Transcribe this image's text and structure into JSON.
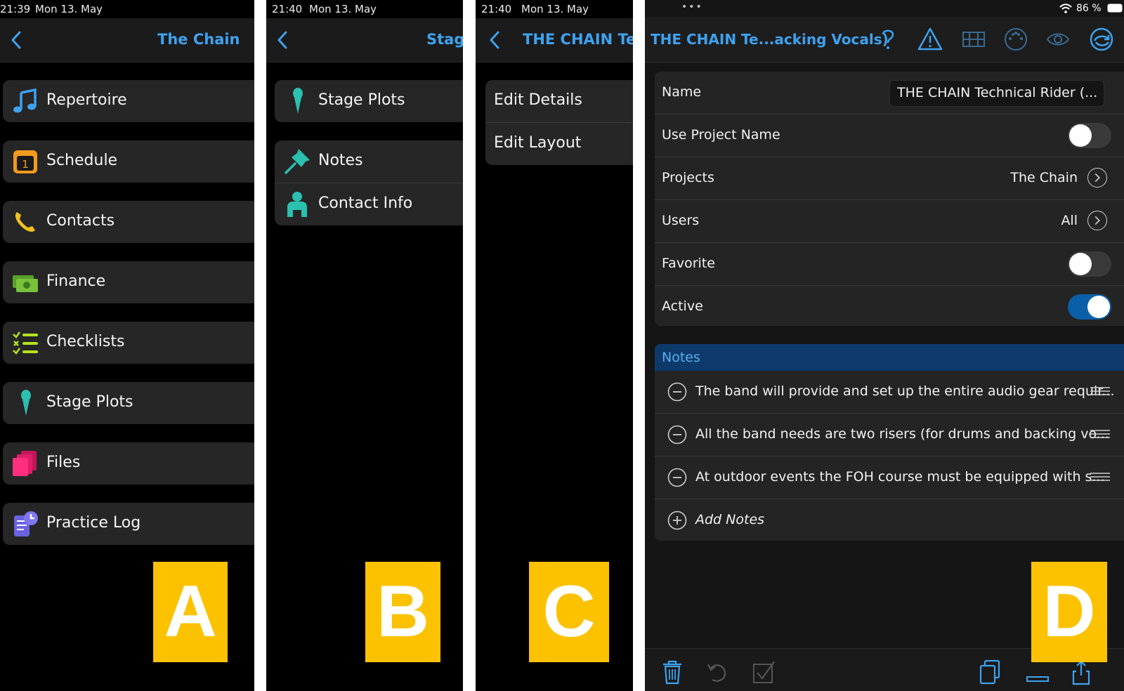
{
  "panel_a": {
    "time": "21:39",
    "date": "Mon 13. May",
    "title": "The Chain",
    "items": [
      {
        "label": "Repertoire"
      },
      {
        "label": "Schedule"
      },
      {
        "label": "Contacts"
      },
      {
        "label": "Finance"
      },
      {
        "label": "Checklists"
      },
      {
        "label": "Stage Plots"
      },
      {
        "label": "Files"
      },
      {
        "label": "Practice Log"
      }
    ],
    "schedule_icon_number": "1",
    "badge": "A"
  },
  "panel_b": {
    "time": "21:40",
    "date": "Mon 13. May",
    "title": "Stage",
    "items": [
      {
        "label": "Stage Plots"
      },
      {
        "label": "Notes"
      },
      {
        "label": "Contact Info"
      }
    ],
    "badge": "B"
  },
  "panel_c": {
    "time": "21:40",
    "date": "Mon 13. May",
    "title": "THE CHAIN Tech",
    "items": [
      {
        "label": "Edit Details"
      },
      {
        "label": "Edit Layout"
      }
    ],
    "badge": "C"
  },
  "panel_d": {
    "status_dots": "•••",
    "battery": "86 %",
    "title": "THE CHAIN Te...acking Vocals)",
    "fields": {
      "name_label": "Name",
      "name_value": "THE CHAIN Technical Rider (...",
      "use_project_name_label": "Use Project Name",
      "use_project_name": false,
      "projects_label": "Projects",
      "projects_value": "The Chain",
      "users_label": "Users",
      "users_value": "All",
      "favorite_label": "Favorite",
      "favorite": false,
      "active_label": "Active",
      "active": true
    },
    "notes": {
      "header": "Notes",
      "items": [
        "The band will provide and set up the entire audio gear requir...",
        "All the band needs are two risers (for drums and backing vo...",
        "At outdoor events the FOH course must be equipped with s..."
      ],
      "add_label": "Add Notes"
    },
    "badge": "D"
  },
  "colors": {
    "accent": "#3ea2ef",
    "badge": "#fcc200",
    "toggle_on": "#0a5fa8",
    "notes_header": "#0e3a6b"
  }
}
